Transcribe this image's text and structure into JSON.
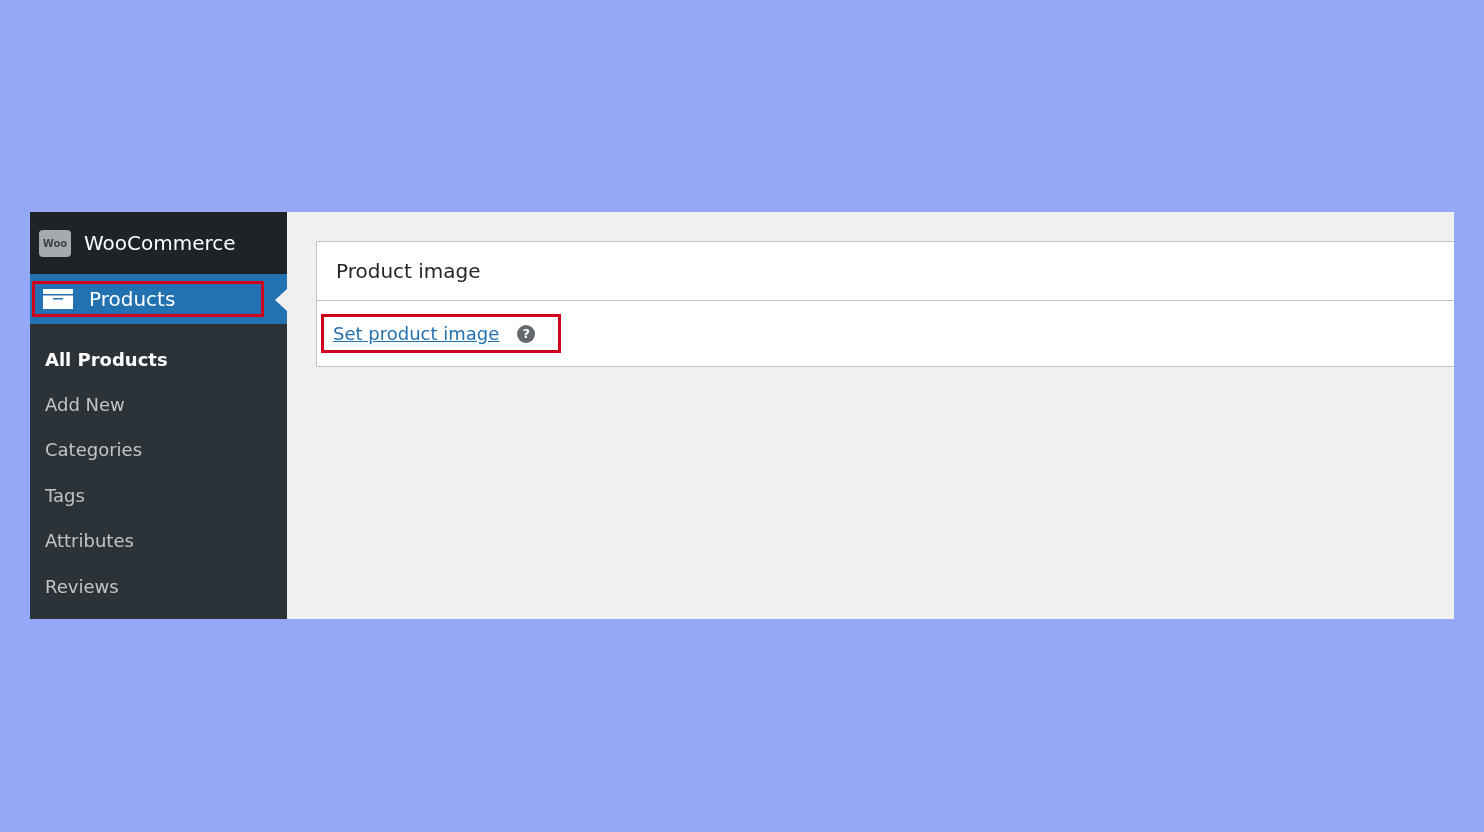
{
  "sidebar": {
    "brand": {
      "logo_text": "Woo",
      "label": "WooCommerce"
    },
    "menu": [
      {
        "label": "Products",
        "selected": true,
        "highlighted": true
      }
    ],
    "submenu": [
      {
        "label": "All Products",
        "selected": true
      },
      {
        "label": "Add New",
        "selected": false
      },
      {
        "label": "Categories",
        "selected": false
      },
      {
        "label": "Tags",
        "selected": false
      },
      {
        "label": "Attributes",
        "selected": false
      },
      {
        "label": "Reviews",
        "selected": false
      }
    ]
  },
  "panel": {
    "title": "Product image",
    "link": {
      "label": "Set product image",
      "highlighted": true
    },
    "help": "?"
  }
}
